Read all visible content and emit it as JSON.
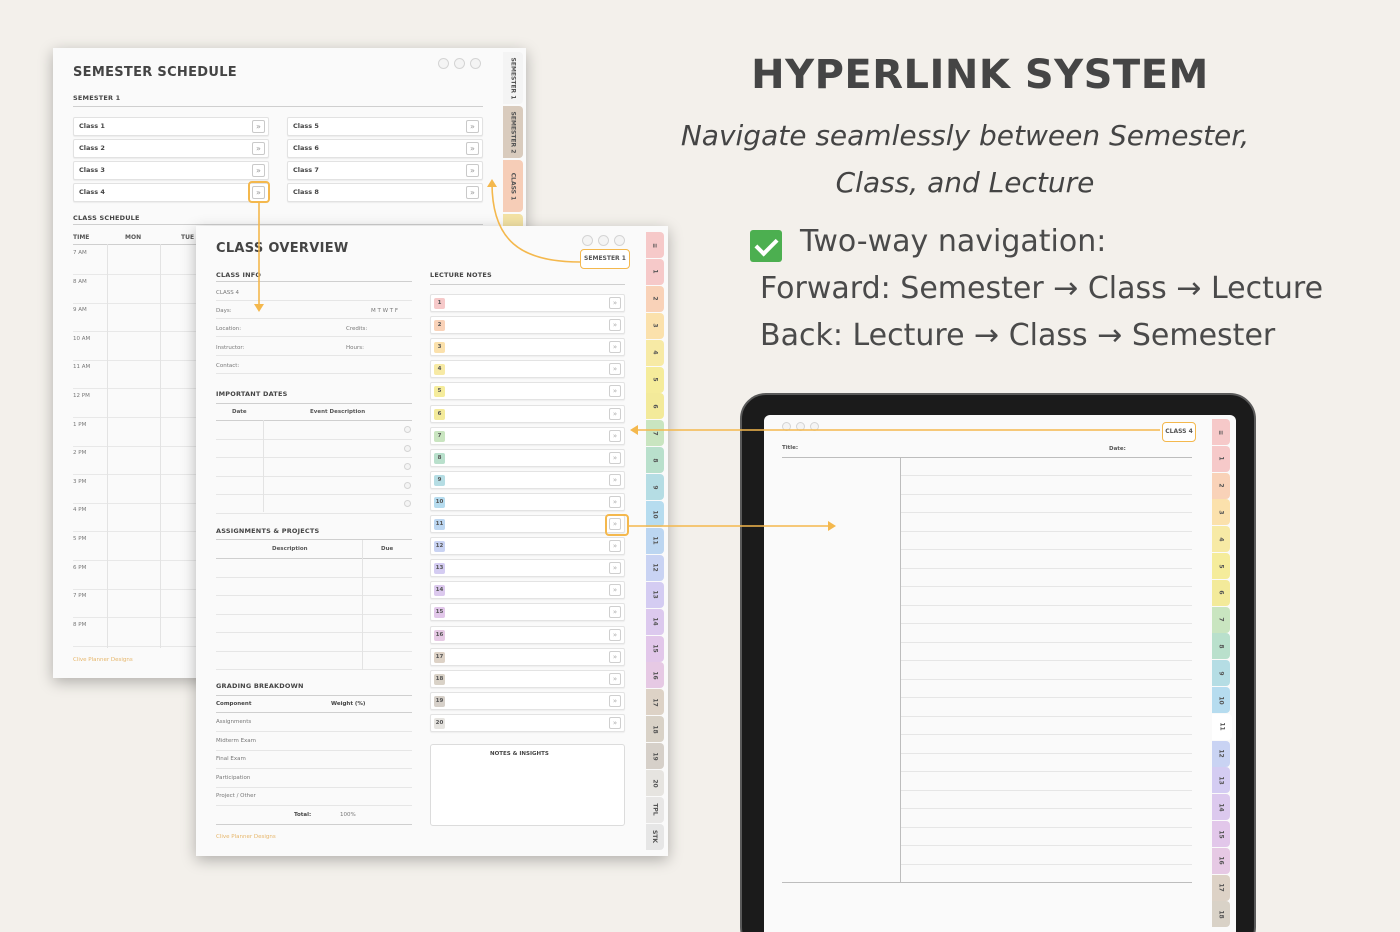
{
  "headline": {
    "title": "HYPERLINK SYSTEM",
    "subtitle_line1": "Navigate seamlessly between Semester,",
    "subtitle_line2": "Class, and Lecture",
    "bullet": "Two-way navigation:",
    "forward": "Forward: Semester → Class → Lecture",
    "back": "Back: Lecture → Class → Semester"
  },
  "semester_page": {
    "title": "SEMESTER SCHEDULE",
    "semester_label": "SEMESTER 1",
    "classes_left": [
      "Class 1",
      "Class 2",
      "Class 3",
      "Class 4"
    ],
    "classes_right": [
      "Class 5",
      "Class 6",
      "Class 7",
      "Class 8"
    ],
    "go_glyph": "»",
    "schedule_label": "CLASS SCHEDULE",
    "schedule_headers": [
      "TIME",
      "MON",
      "TUE"
    ],
    "times": [
      "7 AM",
      "8 AM",
      "9 AM",
      "10 AM",
      "11 AM",
      "12 PM",
      "1 PM",
      "2 PM",
      "3 PM",
      "4 PM",
      "5 PM",
      "6 PM",
      "7 PM",
      "8 PM"
    ],
    "footer": "Clive Planner Designs",
    "tabs": [
      "SEMESTER 1",
      "SEMESTER 2",
      "CLASS 1",
      "C"
    ]
  },
  "class_page": {
    "title": "CLASS OVERVIEW",
    "back_link": "SEMESTER 1",
    "class_info_label": "CLASS INFO",
    "class_name": "CLASS 4",
    "days_label": "Days:",
    "days": "M  T  W  T  F",
    "location_label": "Location:",
    "credits_label": "Credits:",
    "instructor_label": "Instructor:",
    "hours_label": "Hours:",
    "contact_label": "Contact:",
    "important_dates_label": "IMPORTANT DATES",
    "dates_headers": [
      "Date",
      "Event Description"
    ],
    "assignments_label": "ASSIGNMENTS & PROJECTS",
    "assign_headers": [
      "Description",
      "Due"
    ],
    "grading_label": "GRADING BREAKDOWN",
    "grading_headers": [
      "Component",
      "Weight (%)"
    ],
    "grading_rows": [
      "Assignments",
      "Midterm Exam",
      "Final Exam",
      "Participation",
      "Project / Other"
    ],
    "total_label": "Total:",
    "total_value": "100%",
    "lecture_notes_label": "LECTURE NOTES",
    "lectures": [
      "1",
      "2",
      "3",
      "4",
      "5",
      "6",
      "7",
      "8",
      "9",
      "10",
      "11",
      "12",
      "13",
      "14",
      "15",
      "16",
      "17",
      "18",
      "19",
      "20"
    ],
    "notes_label": "NOTES & INSIGHTS",
    "footer": "Clive Planner Designs",
    "tabs": [
      "≡",
      "1",
      "2",
      "3",
      "4",
      "5",
      "6",
      "7",
      "8",
      "9",
      "10",
      "11",
      "12",
      "13",
      "14",
      "15",
      "16",
      "17",
      "18",
      "19",
      "20",
      "TPL",
      "STK"
    ]
  },
  "lecture_page": {
    "back_link": "CLASS 4",
    "title_label": "Title:",
    "date_label": "Date:",
    "tabs": [
      "≡",
      "1",
      "2",
      "3",
      "4",
      "5",
      "6",
      "7",
      "8",
      "9",
      "10",
      "11",
      "12",
      "13",
      "14",
      "15",
      "16",
      "17",
      "18"
    ]
  },
  "colors": {
    "accent": "#f4b84d",
    "tab_colors": [
      "#f6c9c9",
      "#f9d2b8",
      "#fbe1ac",
      "#f7eaa5",
      "#f5ec9b",
      "#f3ea9a",
      "#c9e5c0",
      "#b9e0cc",
      "#b5dde4",
      "#b6dcef",
      "#bcd6f1",
      "#c9d3f3",
      "#d4ccf2",
      "#dcc9ee",
      "#e2c7ea",
      "#e6c9e4",
      "#ddd2c6",
      "#d9d2c7",
      "#d6d0c9",
      "#e6e4e0",
      "#e8e7e6",
      "#e6e6e6"
    ]
  }
}
